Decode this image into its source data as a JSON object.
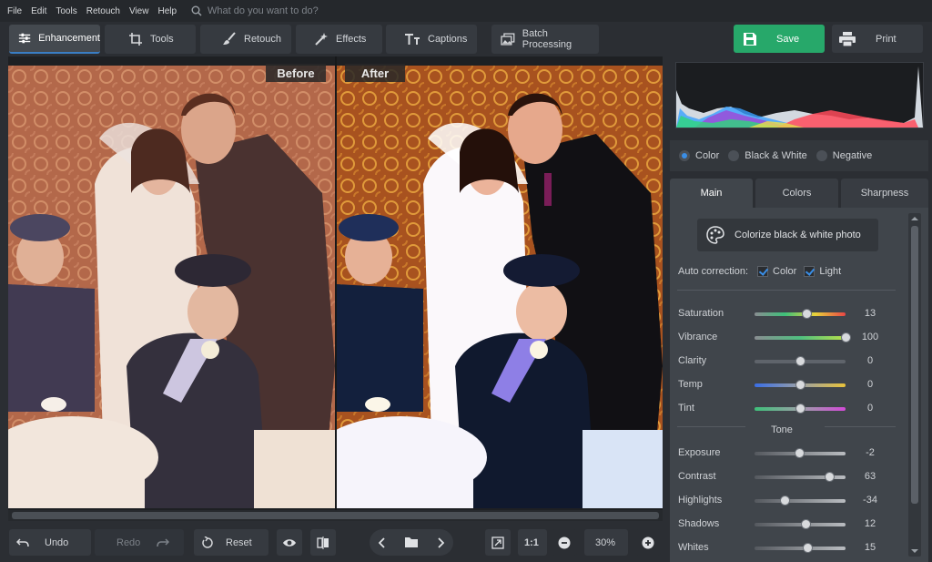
{
  "menu": [
    "File",
    "Edit",
    "Tools",
    "Retouch",
    "View",
    "Help"
  ],
  "search": {
    "placeholder": "What do you want to do?"
  },
  "tabs": [
    {
      "label": "Enhancement",
      "icon": "sliders-icon",
      "active": true
    },
    {
      "label": "Tools",
      "icon": "crop-icon"
    },
    {
      "label": "Retouch",
      "icon": "brush-icon"
    },
    {
      "label": "Effects",
      "icon": "magic-wand-icon"
    },
    {
      "label": "Captions",
      "icon": "text-icon"
    },
    {
      "label": "Batch Processing",
      "icon": "batch-icon"
    }
  ],
  "actions": {
    "save": "Save",
    "print": "Print"
  },
  "compare": {
    "before": "Before",
    "after": "After"
  },
  "bottom": {
    "undo": "Undo",
    "redo": "Redo",
    "reset": "Reset",
    "ratio": "1:1",
    "zoom": "30%"
  },
  "mode": {
    "options": [
      "Color",
      "Black & White",
      "Negative"
    ],
    "selected": "Color"
  },
  "panel_tabs": [
    "Main",
    "Colors",
    "Sharpness"
  ],
  "colorize": "Colorize black & white photo",
  "auto": {
    "label": "Auto correction:",
    "color": "Color",
    "light": "Light",
    "color_checked": true,
    "light_checked": true
  },
  "sliders": [
    {
      "name": "Saturation",
      "value": 13,
      "min": -100,
      "max": 100
    },
    {
      "name": "Vibrance",
      "value": 100,
      "min": -100,
      "max": 100
    },
    {
      "name": "Clarity",
      "value": 0,
      "min": -100,
      "max": 100
    },
    {
      "name": "Temp",
      "value": 0,
      "min": -100,
      "max": 100
    },
    {
      "name": "Tint",
      "value": 0,
      "min": -100,
      "max": 100
    }
  ],
  "tone_label": "Tone",
  "tone_sliders": [
    {
      "name": "Exposure",
      "value": -2,
      "min": -100,
      "max": 100
    },
    {
      "name": "Contrast",
      "value": 63,
      "min": -100,
      "max": 100
    },
    {
      "name": "Highlights",
      "value": -34,
      "min": -100,
      "max": 100
    },
    {
      "name": "Shadows",
      "value": 12,
      "min": -100,
      "max": 100
    },
    {
      "name": "Whites",
      "value": 15,
      "min": -100,
      "max": 100
    }
  ],
  "colors": {
    "accent": "#3a8ee6",
    "save": "#27a86a",
    "panel": "#40454b"
  }
}
